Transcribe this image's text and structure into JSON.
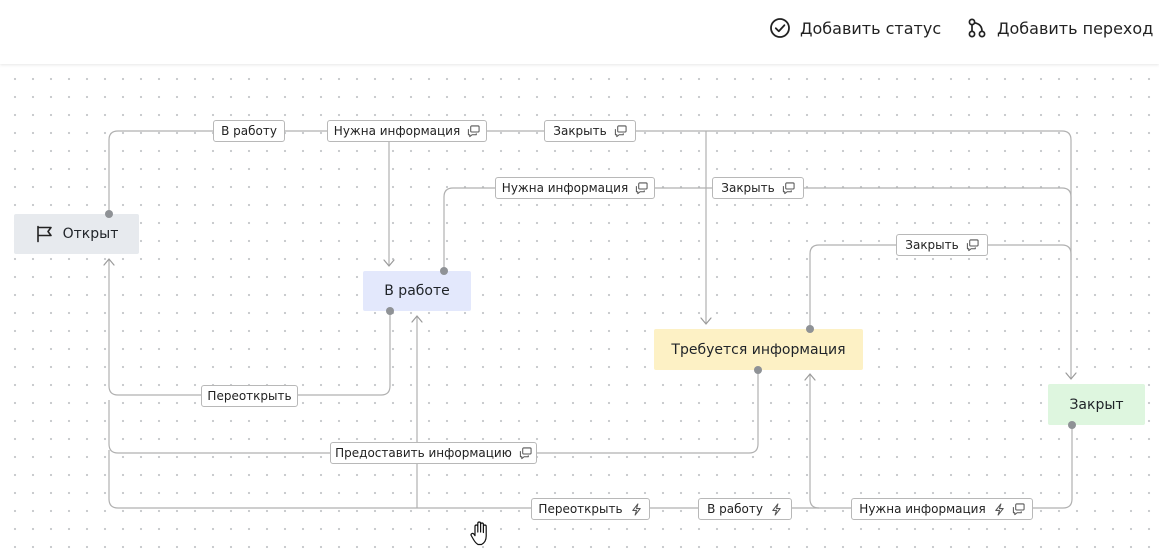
{
  "toolbar": {
    "add_status_label": "Добавить статус",
    "add_transition_label": "Добавить переход",
    "add_status_icon": "check-circle-icon",
    "add_transition_icon": "git-branch-icon"
  },
  "statuses": {
    "open": {
      "label": "Открыт",
      "icon": "flag-icon",
      "color": "#e7eaee"
    },
    "in_progress": {
      "label": "В работе",
      "color": "#e3e8fc"
    },
    "need_info": {
      "label": "Требуется информация",
      "color": "#fdf1c5"
    },
    "closed": {
      "label": "Закрыт",
      "color": "#def6df"
    }
  },
  "transitions": {
    "t1": {
      "label": "В работу",
      "from": "Открыт",
      "to": "В работе"
    },
    "t2": {
      "label": "Нужна информация",
      "icons": [
        "comment-icon"
      ],
      "from": "Открыт",
      "to": "Требуется информация"
    },
    "t3": {
      "label": "Закрыть",
      "icons": [
        "comment-icon"
      ],
      "from": "Открыт",
      "to": "Закрыт"
    },
    "t4": {
      "label": "Нужна информация",
      "icons": [
        "comment-icon"
      ],
      "from": "В работе",
      "to": "Требуется информация"
    },
    "t5": {
      "label": "Закрыть",
      "icons": [
        "comment-icon"
      ],
      "from": "В работе",
      "to": "Закрыт"
    },
    "t6": {
      "label": "Закрыть",
      "icons": [
        "comment-icon"
      ],
      "from": "Требуется информация",
      "to": "Закрыт"
    },
    "t7": {
      "label": "Переоткрыть",
      "from": "В работе",
      "to": "Открыт"
    },
    "t8": {
      "label": "Предоставить информацию",
      "icons": [
        "comment-icon"
      ],
      "from": "Требуется информация",
      "to": "Открыт"
    },
    "t9": {
      "label": "Переоткрыть",
      "icons": [
        "lightning-icon"
      ],
      "from": "Закрыт",
      "to": "Открыт"
    },
    "t10": {
      "label": "В работу",
      "icons": [
        "lightning-icon"
      ],
      "from": "Закрыт",
      "to": "В работе"
    },
    "t11": {
      "label": "Нужна информация",
      "icons": [
        "lightning-icon",
        "comment-icon"
      ],
      "from": "Закрыт",
      "to": "Требуется информация"
    }
  },
  "colors": {
    "edge": "#b0b0b0",
    "port": "#8f9296",
    "label_border": "#b8b8b8"
  }
}
